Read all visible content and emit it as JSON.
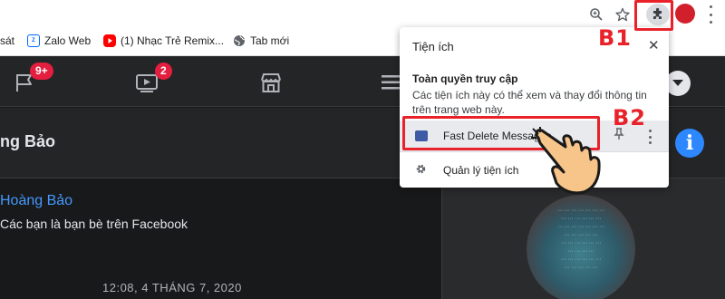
{
  "browser": {
    "bookmarks": [
      {
        "label": "sát",
        "favicon": "none"
      },
      {
        "label": "Zalo Web",
        "favicon": "zalo"
      },
      {
        "label": "(1) Nhạc Trẻ Remix...",
        "favicon": "youtube"
      },
      {
        "label": "Tab mới",
        "favicon": "globe"
      }
    ],
    "icons": [
      "zoom-icon",
      "star-icon",
      "extensions-icon",
      "profile-avatar",
      "menu-icon"
    ]
  },
  "facebook": {
    "nav_badges": {
      "pages": "9+",
      "watch": "2"
    },
    "chat_name": "ng Bảo",
    "profile_name": "Hoàng Bảo",
    "friends_text": "Các bạn là bạn bè trên Facebook",
    "timestamp": "12:08, 4 THÁNG 7, 2020",
    "colors": {
      "background": "#18191a",
      "surface": "#242526",
      "link": "#4599ff",
      "badge": "#e41e3f",
      "info": "#2d88ff"
    }
  },
  "extensions_popup": {
    "title": "Tiện ích",
    "access_heading": "Toàn quyền truy cập",
    "access_description": "Các tiện ích này có thể xem và thay đổi thông tin trên trang web này.",
    "extension_name": "Fast Delete Messages",
    "manage_label": "Quản lý tiện ích"
  },
  "annotations": {
    "step1": "B1",
    "step2": "B2",
    "color": "#e8212a"
  }
}
